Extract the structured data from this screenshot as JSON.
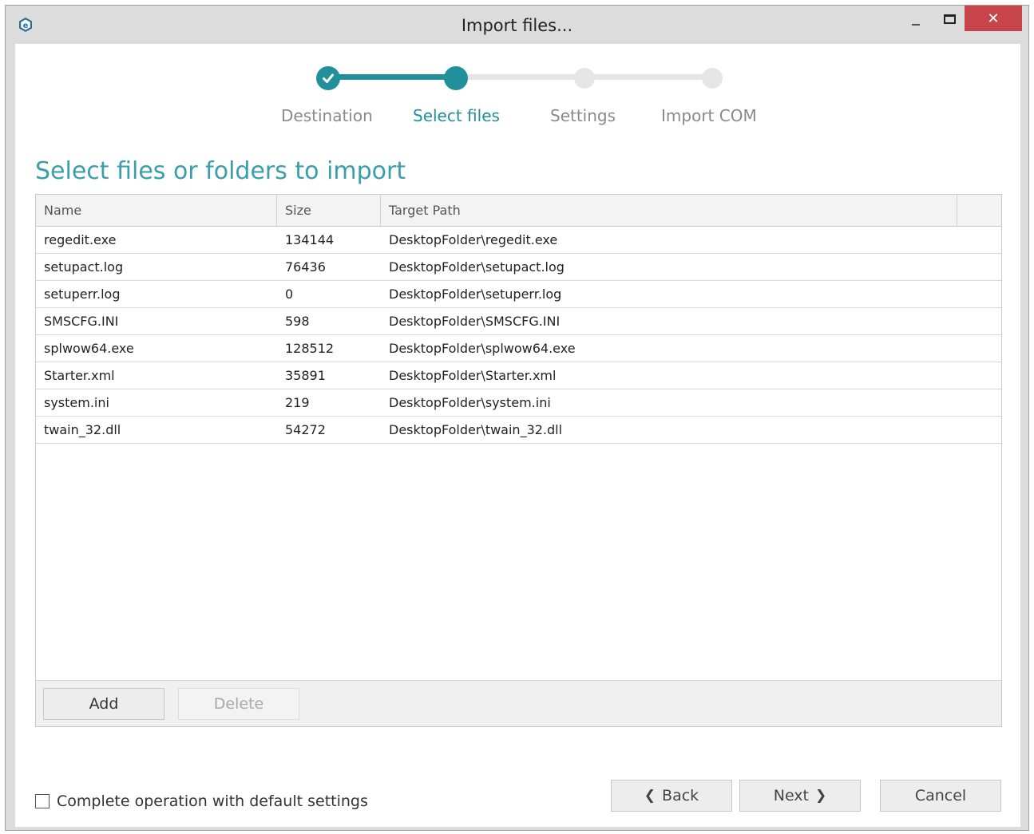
{
  "window": {
    "title": "Import files...",
    "close_glyph": "✕"
  },
  "colors": {
    "accent": "#21909b",
    "heading": "#3a9eab",
    "close_button": "#c7444a",
    "step_inactive": "#e6e6e6"
  },
  "stepper": {
    "steps": [
      {
        "label": "Destination",
        "state": "completed"
      },
      {
        "label": "Select files",
        "state": "current"
      },
      {
        "label": "Settings",
        "state": "pending"
      },
      {
        "label": "Import COM",
        "state": "pending"
      }
    ]
  },
  "heading": "Select files or folders to import",
  "table": {
    "columns": [
      "Name",
      "Size",
      "Target Path"
    ],
    "rows": [
      {
        "name": "regedit.exe",
        "size": "134144",
        "path": "DesktopFolder\\regedit.exe"
      },
      {
        "name": "setupact.log",
        "size": "76436",
        "path": "DesktopFolder\\setupact.log"
      },
      {
        "name": "setuperr.log",
        "size": "0",
        "path": "DesktopFolder\\setuperr.log"
      },
      {
        "name": "SMSCFG.INI",
        "size": "598",
        "path": "DesktopFolder\\SMSCFG.INI"
      },
      {
        "name": "splwow64.exe",
        "size": "128512",
        "path": "DesktopFolder\\splwow64.exe"
      },
      {
        "name": "Starter.xml",
        "size": "35891",
        "path": "DesktopFolder\\Starter.xml"
      },
      {
        "name": "system.ini",
        "size": "219",
        "path": "DesktopFolder\\system.ini"
      },
      {
        "name": "twain_32.dll",
        "size": "54272",
        "path": "DesktopFolder\\twain_32.dll"
      }
    ]
  },
  "toolbar": {
    "add_label": "Add",
    "delete_label": "Delete"
  },
  "footer": {
    "default_settings_label": "Complete operation with default settings",
    "default_settings_checked": false,
    "back_label": "Back",
    "next_label": "Next",
    "cancel_label": "Cancel"
  },
  "icons": {
    "app": "app-logo-icon",
    "check": "checkmark-icon",
    "back": "chevron-left-icon",
    "next": "chevron-right-icon"
  }
}
